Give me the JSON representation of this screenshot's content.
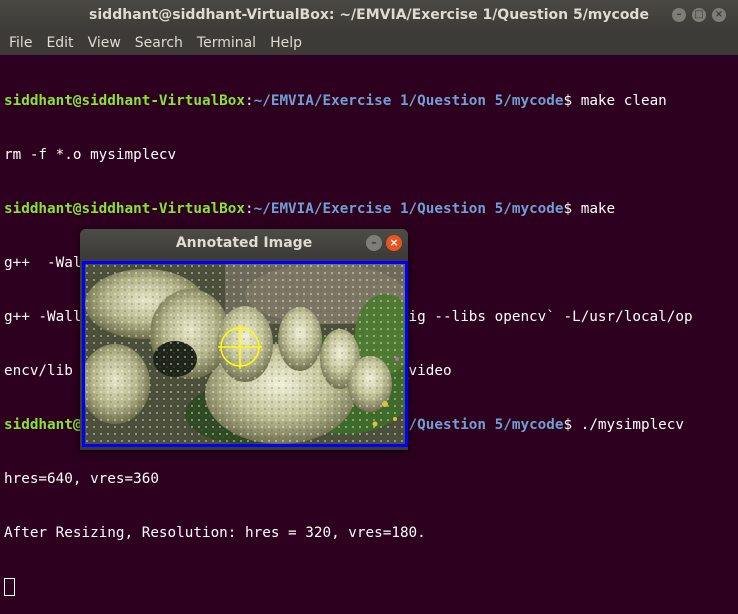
{
  "window": {
    "title": "siddhant@siddhant-VirtualBox: ~/EMVIA/Exercise 1/Question 5/mycode",
    "minimize": "–",
    "maximize": "□",
    "close": "×"
  },
  "menu": [
    "File",
    "Edit",
    "View",
    "Search",
    "Terminal",
    "Help"
  ],
  "prompt": {
    "user": "siddhant@siddhant-VirtualBox",
    "sep": ":",
    "path": "~/EMVIA/Exercise 1/Question 5/mycode",
    "dollar": "$ "
  },
  "terminal": {
    "cmd1": "make clean",
    "out1": "rm -f *.o mysimplecv",
    "cmd2": "make",
    "out2": "g++  -Wall   -c -o mysimplecv.o mysimplecv.cpp",
    "out3": "g++ -Wall  mysimplecv.o -o mysimplecv `pkg-config --libs opencv` -L/usr/local/op",
    "out4": "encv/lib -lopencv_core -lopencv_flann -lopencv_video",
    "cmd3": "./mysimplecv",
    "out5": "hres=640, vres=360",
    "out6": "After Resizing, Resolution: hres = 320, vres=180."
  },
  "dialog": {
    "title": "Annotated Image",
    "minimize": "–",
    "close": "×"
  },
  "colors": {
    "terminal_bg": "#2c001e",
    "prompt_user": "#8ae234",
    "prompt_path": "#729fcf",
    "image_border": "#0000ff",
    "crosshair": "#ffff00"
  }
}
